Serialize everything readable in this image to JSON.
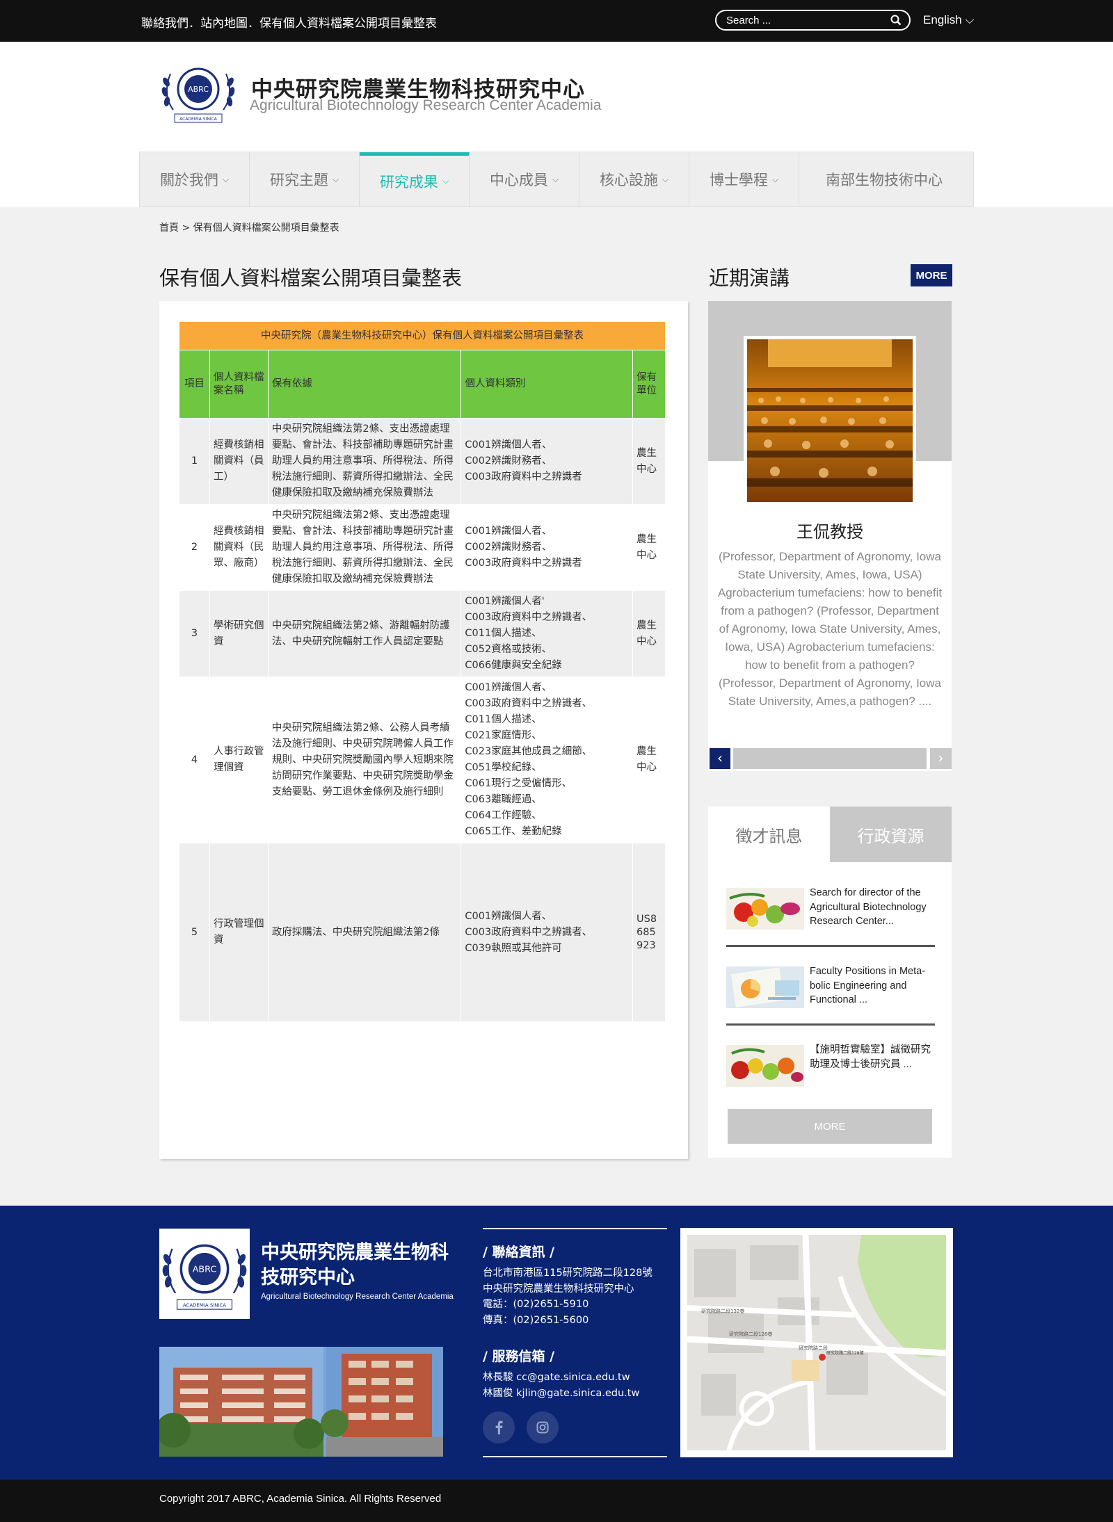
{
  "topbar": {
    "links": "聯絡我們．站內地圖．保有個人資料檔案公開項目彙整表",
    "search_placeholder": "Search ...",
    "language": "English"
  },
  "header": {
    "title": "中央研究院農業生物科技研究中心",
    "subtitle": "Agricultural Biotechnology Research Center Academia",
    "logo_text": "ABRC",
    "logo_ring": "ACADEMIA SINICA"
  },
  "nav": [
    {
      "label": "關於我們",
      "active": false,
      "has_menu": true
    },
    {
      "label": "研究主題",
      "active": false,
      "has_menu": true
    },
    {
      "label": "研究成果",
      "active": true,
      "has_menu": true
    },
    {
      "label": "中心成員",
      "active": false,
      "has_menu": true
    },
    {
      "label": "核心設施",
      "active": false,
      "has_menu": true
    },
    {
      "label": "博士學程",
      "active": false,
      "has_menu": true
    },
    {
      "label": "南部生物技術中心",
      "active": false,
      "has_menu": false
    }
  ],
  "breadcrumb": "首頁 > 保有個人資料檔案公開項目彙整表",
  "page_title": "保有個人資料檔案公開項目彙整表",
  "table": {
    "caption": "中央研究院（農業生物科技研究中心）保有個人資料檔案公開項目彙整表",
    "headers": [
      "項目",
      "個人資料檔案名稱",
      "保有依據",
      "個人資料類別",
      "保有單位"
    ],
    "rows": [
      {
        "no": "1",
        "name": "經費核銷相關資料（員工）",
        "basis": "中央研究院組織法第2條、支出憑證處理要點、會計法、科技部補助專題研究計畫助理人員約用注意事項、所得稅法、所得稅法施行細則、薪資所得扣繳辦法、全民健康保險扣取及繳納補充保險費辦法",
        "categories": [
          "C001辨識個人者、",
          "C002辨識財務者、",
          "C003政府資料中之辨識者"
        ],
        "unit": "農生中心"
      },
      {
        "no": "2",
        "name": "經費核銷相關資料（民眾、廠商）",
        "basis": "中央研究院組織法第2條、支出憑證處理要點、會計法、科技部補助專題研究計畫助理人員約用注意事項、所得稅法、所得稅法施行細則、薪資所得扣繳辦法、全民健康保險扣取及繳納補充保險費辦法",
        "categories": [
          "C001辨識個人者、",
          "C002辨識財務者、",
          "C003政府資料中之辨識者"
        ],
        "unit": "農生中心"
      },
      {
        "no": "3",
        "name": "學術研究個資",
        "basis": "中央研究院組織法第2條、游離輻射防護法、中央研究院輻射工作人員認定要點",
        "categories": [
          "C001辨識個人者'",
          "C003政府資料中之辨識者、",
          "C011個人描述、",
          "C052資格或技術、",
          "C066健康與安全紀錄"
        ],
        "unit": "農生中心"
      },
      {
        "no": "4",
        "name": "人事行政管理個資",
        "basis": "中央研究院組織法第2條、公務人員考績法及施行細則、中央研究院聘僱人員工作規則、中央研究院獎勵國內學人短期來院訪問研究作業要點、中央研究院獎助學金支給要點、勞工退休金條例及施行細則",
        "categories": [
          "C001辨識個人者、",
          "C003政府資料中之辨識者、",
          "C011個人描述、",
          "C021家庭情形、",
          "C023家庭其他成員之細節、",
          "C051學校紀錄、",
          "C061現行之受僱情形、",
          "C063離職經過、",
          "C064工作經驗、",
          "C065工作、差勤紀錄"
        ],
        "unit": "農生中心"
      },
      {
        "no": "5",
        "name": "行政管理個資",
        "basis": "政府採購法、中央研究院組織法第2條",
        "categories": [
          "C001辨識個人者、",
          "C003政府資料中之辨識者、",
          "C039執照或其他許可"
        ],
        "unit": "US8685923"
      }
    ]
  },
  "lectures": {
    "title": "近期演講",
    "more": "MORE",
    "name": "王侃教授",
    "text": "(Professor, Department of Agronomy, Iowa State University, Ames, Iowa, USA) Agrobacterium tumefaciens: how to benefit from a pathogen?  (Professor, Department of Agronomy, Iowa State University, Ames, Iowa, USA) Agrobacterium tumefaciens: how to benefit from a pathogen?  (Professor, Department of Agronomy, Iowa State University, Ames,a pathogen? ....",
    "prev": "‹",
    "next": "›"
  },
  "tabs": {
    "active": "徵才訊息",
    "inactive": "行政資源",
    "items": [
      {
        "text": "Search for director of the Agricultural Biotechnology Research Center..."
      },
      {
        "text": "Faculty Positions in Meta-bolic Engineering and Functional  ..."
      },
      {
        "text": "【施明哲實驗室】誠徵研究助理及博士後研究員 ..."
      }
    ],
    "more": "MORE"
  },
  "footer": {
    "title": "中央研究院農業生物科技研究中心",
    "subtitle": "Agricultural Biotechnology Research Center Academia",
    "contact_heading": "/ 聯絡資訊 /",
    "contact_lines": [
      "台北市南港區115研究院路二段128號",
      "中央研究院農業生物科技研究中心",
      "電話：(02)2651-5910",
      "傳真：(02)2651-5600"
    ],
    "mail_heading": "/ 服務信箱 /",
    "mail_lines": [
      "林長駿 cc@gate.sinica.edu.tw",
      "林國俊 kjlin@gate.sinica.edu.tw"
    ],
    "map_labels": [
      "研究院路二段128巷",
      "研究院路二段",
      "研究院路二段132巷",
      "研究院路二段128號"
    ],
    "copyright": "Copyright 2017 ABRC, Academia Sinica. All Rights Reserved"
  },
  "colors": {
    "accent": "#1cbcb0",
    "navy": "#10236b",
    "footer": "#0a2472",
    "table_caption": "#f8a93a",
    "table_header": "#6fc641"
  }
}
